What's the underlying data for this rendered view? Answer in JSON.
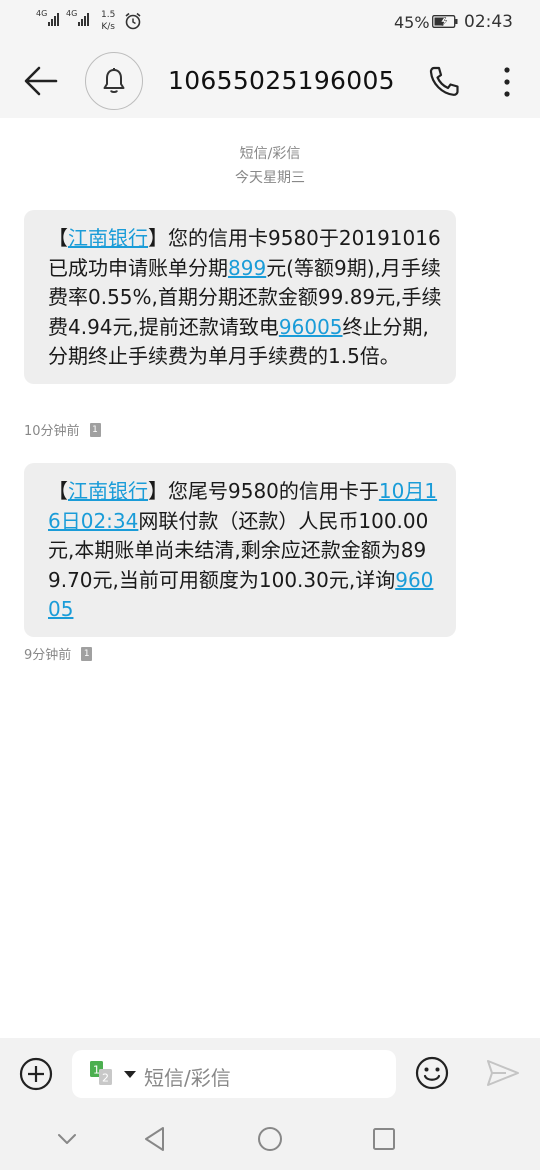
{
  "status_bar": {
    "signal1_label": "4G",
    "signal2_label": "4G",
    "net_speed_value": "1.5",
    "net_speed_unit": "K/s",
    "battery_percent": "45%",
    "time": "02:43"
  },
  "header": {
    "contact": "10655025196005",
    "icons": [
      "back-arrow-icon",
      "bell-icon",
      "phone-icon",
      "more-vertical-icon"
    ]
  },
  "thread": {
    "type_label": "短信/彩信",
    "date_label": "今天星期三"
  },
  "messages": [
    {
      "segments": [
        {
          "text": "【",
          "link": false
        },
        {
          "text": "江南银行",
          "link": true
        },
        {
          "text": "】您的信用卡9580于20191016已成功申请账单分期",
          "link": false
        },
        {
          "text": "899",
          "link": true
        },
        {
          "text": "元(等额9期),月手续费率0.55%,首期分期还款金额99.89元,手续费4.94元,提前还款请致电",
          "link": false
        },
        {
          "text": "96005",
          "link": true
        },
        {
          "text": "终止分期,分期终止手续费为单月手续费的1.5倍。",
          "link": false
        }
      ],
      "time": "10分钟前",
      "sim": "1"
    },
    {
      "segments": [
        {
          "text": "【",
          "link": false
        },
        {
          "text": "江南银行",
          "link": true
        },
        {
          "text": "】您尾号9580的信用卡于",
          "link": false
        },
        {
          "text": "10月16日02:34",
          "link": true
        },
        {
          "text": "网联付款（还款）人民币100.00元,本期账单尚未结清,剩余应还款金额为899.70元,当前可用额度为100.30元,详询",
          "link": false
        },
        {
          "text": "96005",
          "link": true
        }
      ],
      "time": "9分钟前",
      "sim": "1"
    }
  ],
  "composer": {
    "placeholder": "短信/彩信",
    "sim_badge": "12",
    "icons": [
      "add-circle-icon",
      "sim-switch-icon",
      "emoji-icon",
      "send-icon"
    ]
  },
  "nav": {
    "icons": [
      "hide-keyboard-icon",
      "nav-back-icon",
      "nav-home-icon",
      "nav-recent-icon"
    ]
  },
  "colors": {
    "link": "#1a9cd8",
    "bubble": "#eeeeee",
    "bar_bg": "#f5f5f5",
    "sim_green": "#4caf50"
  }
}
